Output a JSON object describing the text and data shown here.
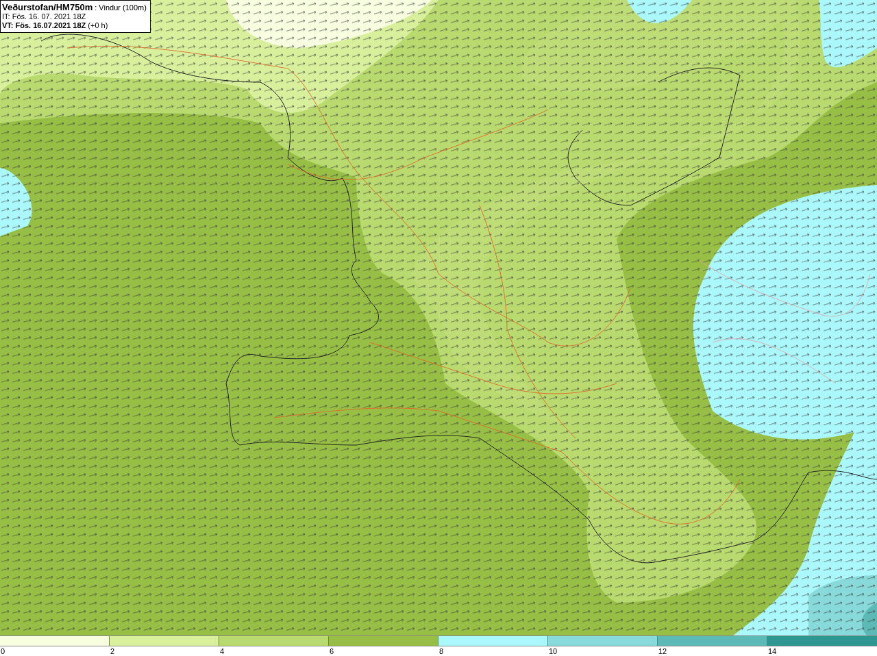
{
  "header": {
    "title_line": "**Veðurstofan/HM750m** : Vindur (100m)",
    "issue_time": "IT: Fös. 16. 07. 2021 18Z",
    "valid_time": "**VT: Fös. 16.07.2021 18Z** (+0 h)"
  },
  "legend": {
    "swatches": [
      {
        "color": "#f8fee0"
      },
      {
        "color": "#d8f09c"
      },
      {
        "color": "#b8da6e"
      },
      {
        "color": "#98bf45"
      },
      {
        "color": "#aaf8fc"
      },
      {
        "color": "#88dada"
      },
      {
        "color": "#5db9b6"
      },
      {
        "color": "#2e9792"
      }
    ],
    "ticks": [
      "0",
      "2",
      "4",
      "6",
      "8",
      "10",
      "12",
      "14"
    ]
  }
}
